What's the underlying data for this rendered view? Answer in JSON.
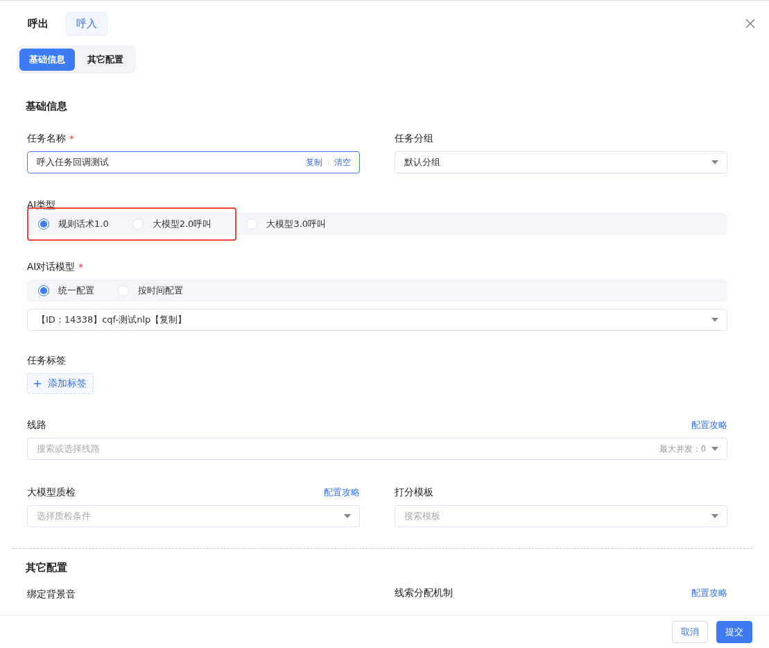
{
  "tabs": [
    {
      "label": "呼出",
      "selected": false
    },
    {
      "label": "呼入",
      "selected": true
    }
  ],
  "segments": [
    {
      "label": "基础信息",
      "selected": true
    },
    {
      "label": "其它配置",
      "selected": false
    }
  ],
  "basic_section": {
    "title": "基础信息",
    "task_name": {
      "label": "任务名称",
      "required_mark": "*",
      "value": "呼入任务回调测试",
      "actions": [
        "复制",
        "清空"
      ]
    },
    "task_group": {
      "label": "任务分组",
      "value": "默认分组"
    },
    "ai_type": {
      "label": "AI类型",
      "options": [
        {
          "label": "规则话术1.0",
          "selected": true,
          "highlighted": true
        },
        {
          "label": "大模型2.0呼叫",
          "selected": false,
          "highlighted": true
        },
        {
          "label": "大模型3.0呼叫",
          "selected": false,
          "highlighted": false
        }
      ]
    },
    "dialog_model": {
      "label": "AI对话模型",
      "required_mark": "*",
      "options": [
        {
          "label": "统一配置",
          "selected": true
        },
        {
          "label": "按时间配置",
          "selected": false
        }
      ],
      "value": "【ID：14338】cqf-测试nlp【复制】"
    },
    "task_tags": {
      "label": "任务标签",
      "button": "添加标签"
    },
    "line": {
      "label": "线路",
      "link": "配置攻略",
      "placeholder": "搜索或选择线路",
      "suffix": "最大并发：0"
    },
    "qa": {
      "label": "大模型质检",
      "link": "配置攻略",
      "placeholder": "选择质检条件"
    },
    "score_template": {
      "label": "打分模板",
      "placeholder": "搜索模板"
    }
  },
  "other_section": {
    "title": "其它配置",
    "left_label": "绑定背景音",
    "right_label": "线索分配机制",
    "right_link": "配置攻略"
  },
  "footer": {
    "cancel": "取消",
    "submit": "提交"
  }
}
